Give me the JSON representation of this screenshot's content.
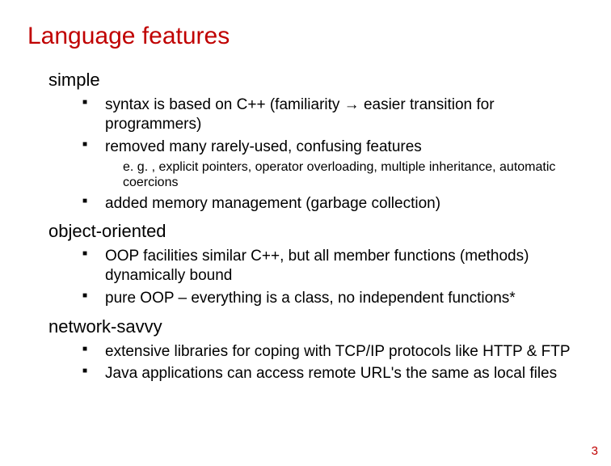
{
  "title": "Language features",
  "sections": [
    {
      "heading": "simple",
      "items": [
        {
          "text": "syntax is based on C++ (familiarity → easier transition for programmers)"
        },
        {
          "text": "removed many rarely-used, confusing features",
          "sub": "e. g. , explicit pointers, operator overloading, multiple inheritance, automatic coercions"
        },
        {
          "text": "added memory management (garbage collection)"
        }
      ]
    },
    {
      "heading": "object-oriented",
      "items": [
        {
          "text": "OOP facilities similar C++, but all member functions (methods) dynamically bound"
        },
        {
          "text": "pure OOP – everything is a class, no independent functions*"
        }
      ]
    },
    {
      "heading": "network-savvy",
      "items": [
        {
          "text": "extensive libraries for coping with TCP/IP protocols like HTTP & FTP"
        },
        {
          "text": "Java applications can access remote URL's the same as local files"
        }
      ]
    }
  ],
  "page_number": "3"
}
